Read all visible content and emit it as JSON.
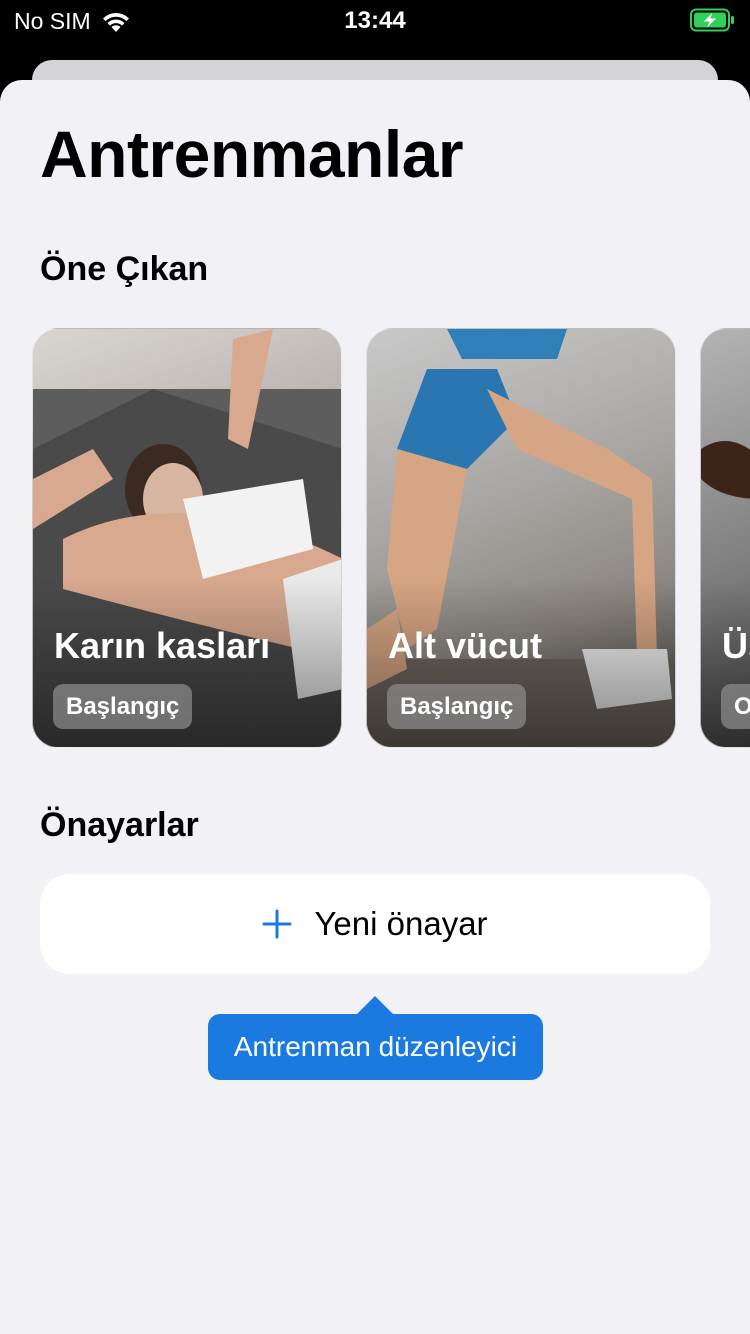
{
  "status_bar": {
    "carrier": "No SIM",
    "time": "13:44",
    "wifi_icon": "wifi-icon",
    "battery_icon": "battery-charging-icon",
    "battery_color": "#30d158"
  },
  "page": {
    "title": "Antrenmanlar"
  },
  "featured": {
    "section_title": "Öne Çıkan",
    "cards": [
      {
        "title": "Karın kasları",
        "level": "Başlangıç"
      },
      {
        "title": "Alt vücut",
        "level": "Başlangıç"
      },
      {
        "title": "Üs",
        "level": "O"
      }
    ]
  },
  "presets": {
    "section_title": "Önayarlar",
    "new_button_label": "Yeni önayar",
    "new_button_icon": "plus-icon"
  },
  "tooltip": {
    "text": "Antrenman düzenleyici"
  },
  "colors": {
    "accent": "#1a7ae0",
    "background": "#f1f1f6",
    "card_surface": "#ffffff"
  }
}
